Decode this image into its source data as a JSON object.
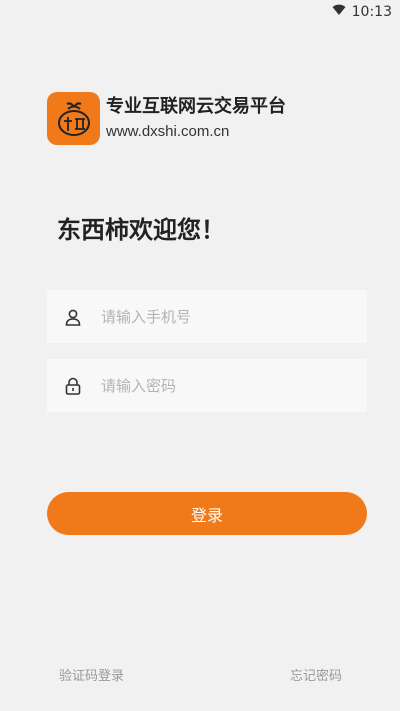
{
  "status_bar": {
    "time": "10:13",
    "wifi_icon": "wifi-icon"
  },
  "brand": {
    "logo_icon": "persimmon-logo-icon",
    "slogan": "专业互联网云交易平台",
    "site": "www.dxshi.com.cn"
  },
  "welcome": "东西柿欢迎您！",
  "phone_field": {
    "placeholder": "请输入手机号",
    "icon": "user-icon"
  },
  "password_field": {
    "placeholder": "请输入密码",
    "icon": "lock-icon"
  },
  "login_button": "登录",
  "sms_login_link": "验证码登录",
  "forgot_password_link": "忘记密码",
  "colors": {
    "accent": "#f07a1a",
    "background": "#f1f1f1"
  }
}
